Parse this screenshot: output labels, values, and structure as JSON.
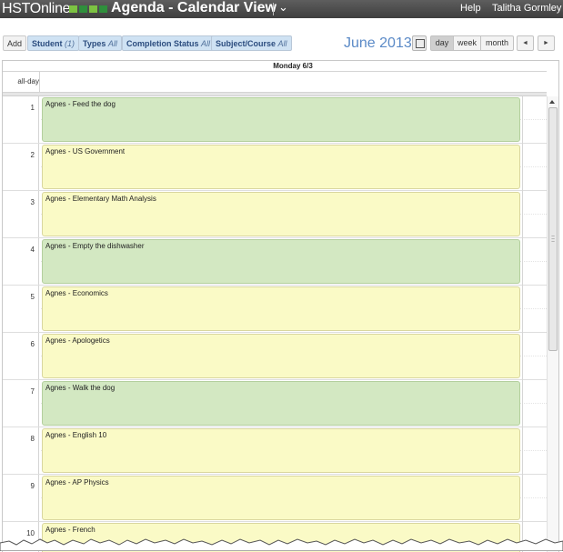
{
  "header": {
    "logo_text": "HSTOnline",
    "title": "Agenda - Calendar View",
    "help_label": "Help",
    "user_name": "Talitha Gormley",
    "logo_colors": [
      "#7cc242",
      "#2f8f3c",
      "#7cc242",
      "#2f8f3c"
    ]
  },
  "toolbar": {
    "add_label": "Add",
    "filters": [
      {
        "label": "Student",
        "value": "(1)"
      },
      {
        "label": "Types",
        "value": "All"
      },
      {
        "label": "Completion Status",
        "value": "All"
      },
      {
        "label": "Subject/Course",
        "value": "All"
      }
    ],
    "month_title": "June 2013",
    "views": {
      "day": "day",
      "week": "week",
      "month": "month"
    },
    "active_view": "day",
    "prev_label": "◄",
    "next_label": "►"
  },
  "calendar": {
    "day_header": "Monday 6/3",
    "allday_label": "all-day",
    "hours": [
      "1",
      "2",
      "3",
      "4",
      "5",
      "6",
      "7",
      "8",
      "9",
      "10"
    ],
    "events": [
      {
        "title": "Agnes - Feed the dog",
        "color": "green"
      },
      {
        "title": "Agnes - US Government",
        "color": "yellow"
      },
      {
        "title": "Agnes - Elementary Math Analysis",
        "color": "yellow"
      },
      {
        "title": "Agnes - Empty the dishwasher",
        "color": "green"
      },
      {
        "title": "Agnes - Economics",
        "color": "yellow"
      },
      {
        "title": "Agnes - Apologetics",
        "color": "yellow"
      },
      {
        "title": "Agnes - Walk the dog",
        "color": "green"
      },
      {
        "title": "Agnes - English 10",
        "color": "yellow"
      },
      {
        "title": "Agnes - AP Physics",
        "color": "yellow"
      },
      {
        "title": "Agnes - French",
        "color": "yellow"
      }
    ]
  }
}
